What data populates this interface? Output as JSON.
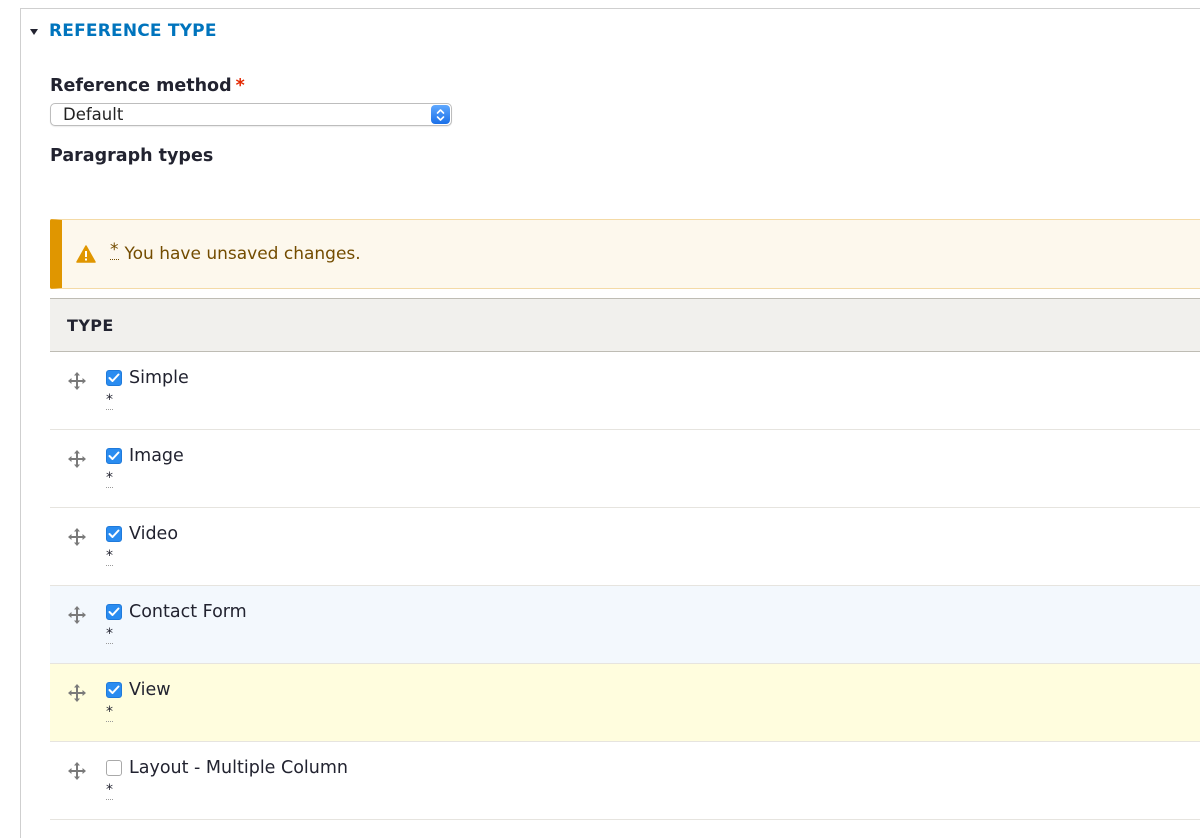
{
  "details": {
    "summary": "REFERENCE TYPE"
  },
  "reference_method": {
    "label": "Reference method",
    "required_marker": "*",
    "selected": "Default"
  },
  "paragraph_types_label": "Paragraph types",
  "warning": {
    "marker": "*",
    "message": "You have unsaved changes."
  },
  "table": {
    "header": "TYPE",
    "rows": [
      {
        "label": "Simple",
        "checked": true,
        "marker": "*"
      },
      {
        "label": "Image",
        "checked": true,
        "marker": "*"
      },
      {
        "label": "Video",
        "checked": true,
        "marker": "*"
      },
      {
        "label": "Contact Form",
        "checked": true,
        "marker": "*"
      },
      {
        "label": "View",
        "checked": true,
        "marker": "*"
      },
      {
        "label": "Layout - Multiple Column",
        "checked": false,
        "marker": "*"
      }
    ]
  },
  "icons": {
    "summary": "triangle-down-icon",
    "select": "select-stepper-icon",
    "warning": "warning-icon",
    "drag": "drag-handle-icon",
    "check": "checkmark-icon"
  },
  "colors": {
    "link": "#0074bd",
    "required": "#e32700",
    "warning_bar": "#e09600",
    "warning_bg": "#fdf8ed",
    "checkbox": "#2a8cf0",
    "row_blue": "#f3f8fd",
    "row_yellow": "#fffdde"
  }
}
